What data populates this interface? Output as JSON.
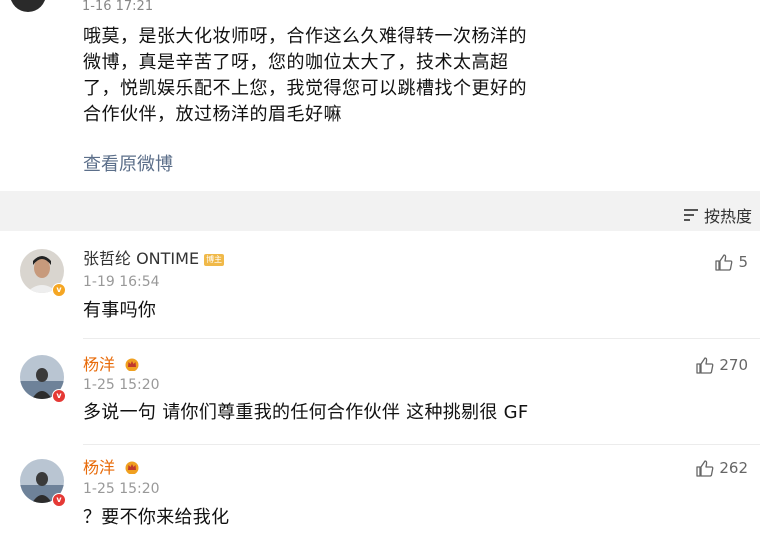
{
  "post": {
    "time": "1-16 17:21",
    "text_lines": [
      "哦莫，是张大化妆师呀，合作这么久难得转一次杨洋的",
      "微博，真是辛苦了呀，您的咖位太大了，技术太高超",
      "了，悦凯娱乐配不上您，我觉得您可以跳槽找个更好的",
      "合作伙伴，放过杨洋的眉毛好嘛"
    ],
    "view_original": "查看原微博"
  },
  "sort": {
    "label": "按热度",
    "icon": "sort-icon"
  },
  "comments": [
    {
      "name": "张哲纶 ONTIME",
      "tag": "博主",
      "time": "1-19 16:54",
      "text": "有事吗你",
      "likes": "5",
      "badge_color": "#f5a623",
      "badge_icon": "verified-yellow-icon"
    },
    {
      "name": "杨洋",
      "time": "1-25 15:20",
      "text": "多说一句 请你们尊重我的任何合作伙伴 这种挑剔很 GF",
      "likes": "270",
      "badge_color": "#e53935",
      "badge_icon": "verified-red-icon",
      "vip_icon": "crown-icon"
    },
    {
      "name": "杨洋",
      "time": "1-25 15:20",
      "text": "？要不你来给我化",
      "likes": "262",
      "badge_color": "#e53935",
      "badge_icon": "verified-red-icon",
      "vip_icon": "crown-icon"
    }
  ],
  "colors": {
    "link": "#5c6f8a",
    "vip_name": "#e86b0a",
    "background": "#f2f2f2"
  }
}
